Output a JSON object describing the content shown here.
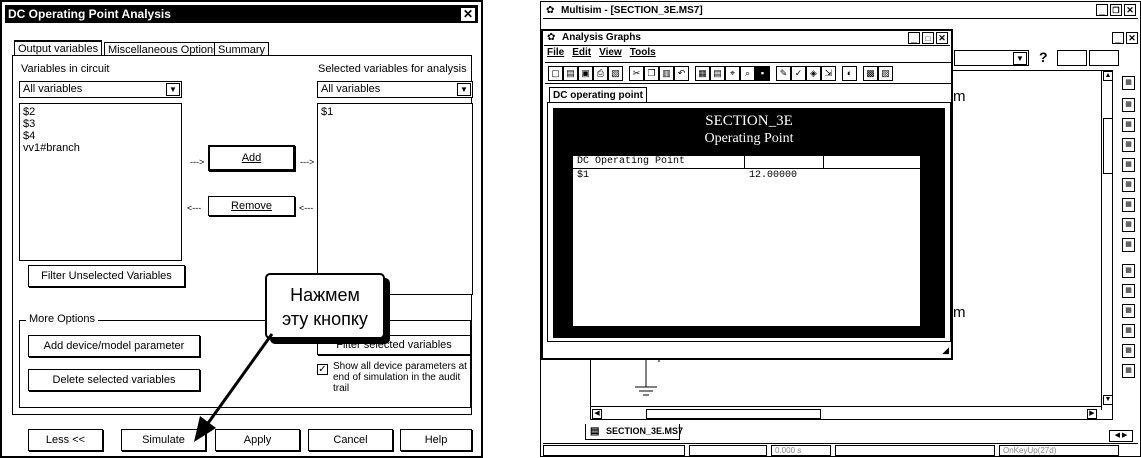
{
  "dialog": {
    "title": "DC Operating Point Analysis",
    "close_glyph": "✕",
    "tabs": [
      "Output variables",
      "Miscellaneous Options",
      "Summary"
    ],
    "vars_label": "Variables in circuit",
    "vars_filter": "All variables",
    "vars_items": [
      "$2",
      "$3",
      "$4",
      "vv1#branch"
    ],
    "selected_label": "Selected variables for analysis",
    "selected_filter": "All variables",
    "selected_items": [
      "$1"
    ],
    "add_label": "Add",
    "remove_label": "Remove",
    "arrow_right": "--->",
    "arrow_left": "<---",
    "filter_unselected_label": "Filter Unselected Variables",
    "more_options_label": "More Options",
    "add_param_label": "Add device/model parameter",
    "delete_selected_label": "Delete selected variables",
    "filter_selected_label": "Filter selected variables",
    "show_params_label": "Show all device parameters at end of simulation in the audit trail",
    "show_params_checked": true,
    "buttons": {
      "less": "Less <<",
      "simulate": "Simulate",
      "apply": "Apply",
      "cancel": "Cancel",
      "help": "Help"
    }
  },
  "callout": {
    "line1": "Нажмем",
    "line2": "эту кнопку"
  },
  "multisim": {
    "title": "Multisim - [SECTION_3E.MS7]",
    "help_glyph": "?",
    "sheet_tab": "SECTION_3E.MS7",
    "status_time": "0.000 s",
    "status_event": "OnKeyUp(27d)",
    "grapher": {
      "title": "Analysis Graphs",
      "menu": [
        "File",
        "Edit",
        "View",
        "Tools"
      ],
      "tab": "DC operating point",
      "heading1": "SECTION_3E",
      "heading2": "Operating Point",
      "table_header": "DC Operating Point",
      "row_name": "$1",
      "row_value": "12.00000"
    },
    "side_letter": "m",
    "colors": {
      "dark": "#000000",
      "light": "#ffffff"
    }
  }
}
